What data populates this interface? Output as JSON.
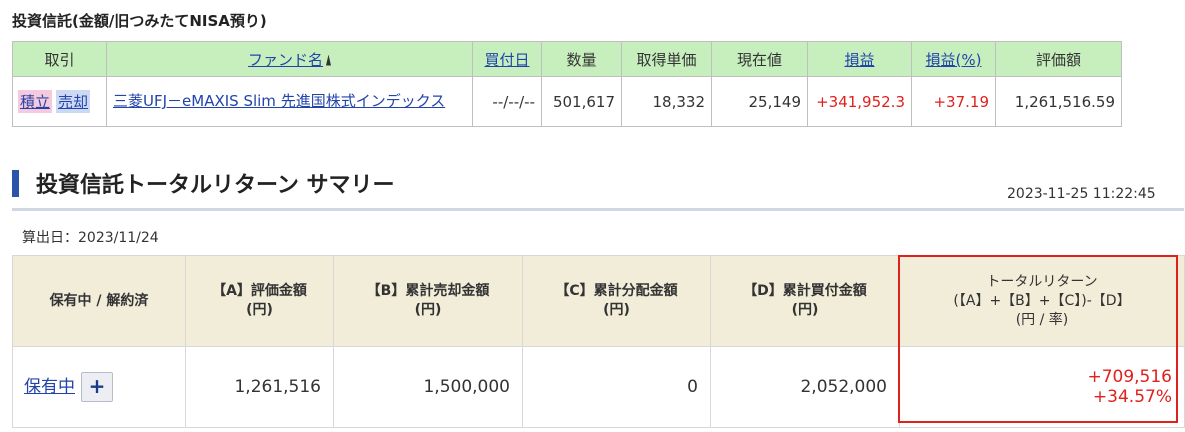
{
  "holdings_section": {
    "title": "投資信託(金額/旧つみたてNISA預り)",
    "columns": {
      "trade": "取引",
      "fund_name": "ファンド名",
      "buy_date": "買付日",
      "quantity": "数量",
      "unit_cost": "取得単価",
      "current_price": "現在値",
      "profit": "損益",
      "profit_pct": "損益(%)",
      "valuation": "評価額"
    },
    "rows": [
      {
        "buy_label": "積立",
        "sell_label": "売却",
        "fund_name": "三菱UFJ－eMAXIS Slim 先進国株式インデックス",
        "buy_date": "--/--/--",
        "quantity": "501,617",
        "unit_cost": "18,332",
        "current_price": "25,149",
        "profit": "+341,952.3",
        "profit_pct": "+37.19",
        "valuation": "1,261,516.59"
      }
    ]
  },
  "summary_section": {
    "title": "投資信託トータルリターン サマリー",
    "timestamp": "2023-11-25 11:22:45",
    "calc_date": "算出日：2023/11/24",
    "headers": {
      "status": "保有中 / 解約済",
      "a_line1": "【A】評価金額",
      "a_line2": "(円)",
      "b_line1": "【B】累計売却金額",
      "b_line2": "(円)",
      "c_line1": "【C】累計分配金額",
      "c_line2": "(円)",
      "d_line1": "【D】累計買付金額",
      "d_line2": "(円)",
      "total_line1": "トータルリターン",
      "total_line2": "(【A】+【B】+【C】)-【D】",
      "total_line3": "(円 / 率)"
    },
    "row": {
      "status": "保有中",
      "expand_symbol": "+",
      "a": "1,261,516",
      "b": "1,500,000",
      "c": "0",
      "d": "2,052,000",
      "total_amount": "+709,516",
      "total_rate": "+34.57%"
    }
  },
  "colors": {
    "table_header_green": "#c6efbd",
    "summary_header_beige": "#f2edd9",
    "positive_red": "#e0201d",
    "link_blue": "#2244aa",
    "section_bar_blue": "#2a55a8",
    "highlight_border": "#e0201d"
  }
}
